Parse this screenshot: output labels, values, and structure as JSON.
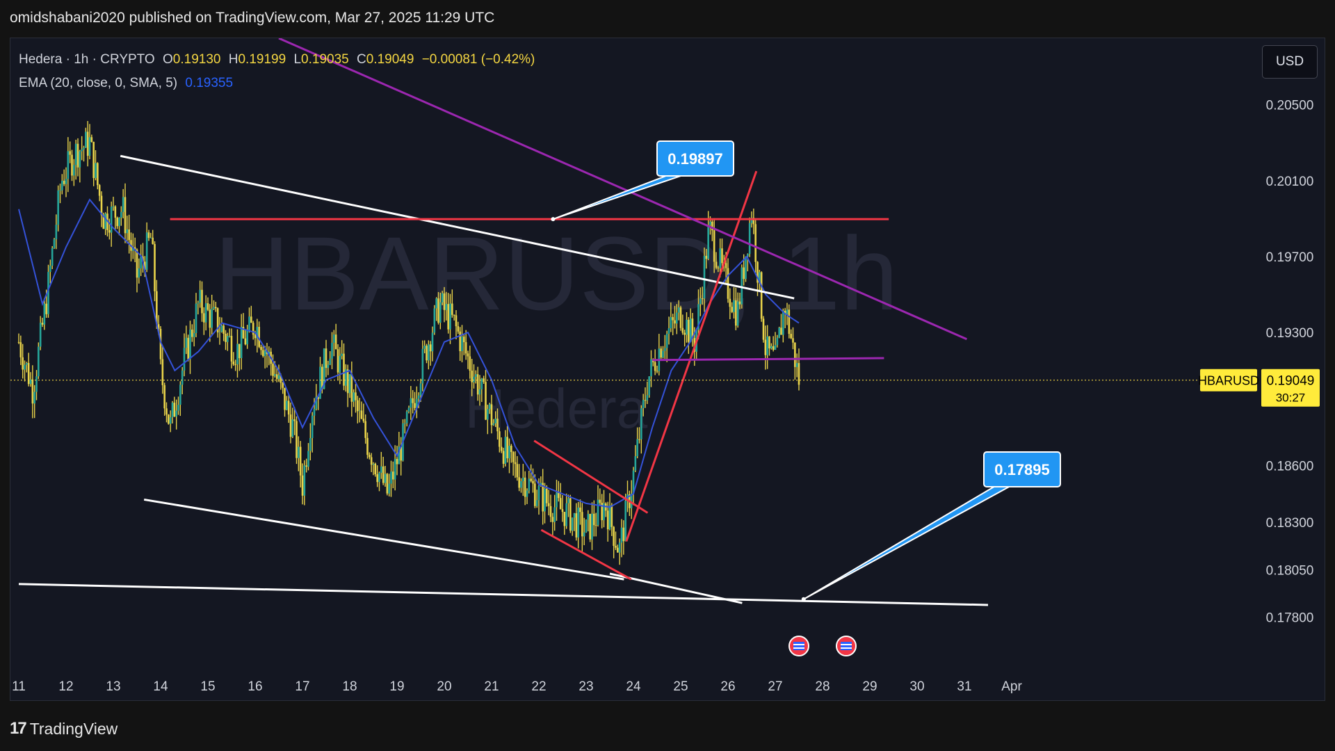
{
  "header": {
    "publisher": "omidshabani2020 published on TradingView.com, Mar 27, 2025 11:29 UTC"
  },
  "legend": {
    "symbol": "Hedera · 1h · CRYPTO",
    "o_label": "O",
    "o_value": "0.19130",
    "h_label": "H",
    "h_value": "0.19199",
    "l_label": "L",
    "l_value": "0.19035",
    "c_label": "C",
    "c_value": "0.19049",
    "change": "−0.00081 (−0.42%)",
    "ema_label": "EMA (20, close, 0, SMA, 5)",
    "ema_value": "0.19355"
  },
  "currency_button": "USD",
  "watermark": {
    "symbol": "HBARUSD, 1h",
    "name": "Hedera"
  },
  "footer": {
    "brand": "TradingView"
  },
  "colors": {
    "background": "#141722",
    "candles": "#e8d34a",
    "ema": "#3452d9",
    "resistance": "#f23645",
    "trendline": "#ffffff",
    "purple": "#9c27b0",
    "label_blue": "#2196f3",
    "price_tag": "#ffeb3b"
  },
  "chart_data": {
    "type": "line",
    "symbol": "HBARUSD",
    "timeframe": "1h",
    "x_ticks": [
      "11",
      "12",
      "13",
      "14",
      "15",
      "16",
      "17",
      "18",
      "19",
      "20",
      "21",
      "22",
      "23",
      "24",
      "25",
      "26",
      "27",
      "28",
      "29",
      "30",
      "31",
      "Apr"
    ],
    "y_ticks": [
      "0.20500",
      "0.20100",
      "0.19700",
      "0.19300",
      "0.18600",
      "0.18300",
      "0.18050",
      "0.17800"
    ],
    "ylim": [
      0.177,
      0.2085
    ],
    "current_price": {
      "symbol": "HBARUSD",
      "value": "0.19049",
      "countdown": "30:27"
    },
    "levels": [
      {
        "name": "resistance",
        "price": 0.19897,
        "label": "0.19897"
      },
      {
        "name": "support",
        "price": 0.17895,
        "label": "0.17895"
      }
    ],
    "close_series": [
      {
        "day": 11.0,
        "price": 0.1925
      },
      {
        "day": 11.3,
        "price": 0.19
      },
      {
        "day": 11.6,
        "price": 0.195
      },
      {
        "day": 11.9,
        "price": 0.201
      },
      {
        "day": 12.2,
        "price": 0.2025
      },
      {
        "day": 12.5,
        "price": 0.203
      },
      {
        "day": 12.8,
        "price": 0.199
      },
      {
        "day": 13.2,
        "price": 0.1995
      },
      {
        "day": 13.5,
        "price": 0.196
      },
      {
        "day": 13.8,
        "price": 0.198
      },
      {
        "day": 14.0,
        "price": 0.191
      },
      {
        "day": 14.2,
        "price": 0.188
      },
      {
        "day": 14.5,
        "price": 0.1915
      },
      {
        "day": 14.8,
        "price": 0.1945
      },
      {
        "day": 15.2,
        "price": 0.1935
      },
      {
        "day": 15.6,
        "price": 0.192
      },
      {
        "day": 16.0,
        "price": 0.1935
      },
      {
        "day": 16.4,
        "price": 0.191
      },
      {
        "day": 16.8,
        "price": 0.188
      },
      {
        "day": 17.0,
        "price": 0.185
      },
      {
        "day": 17.2,
        "price": 0.189
      },
      {
        "day": 17.6,
        "price": 0.1925
      },
      {
        "day": 18.0,
        "price": 0.19
      },
      {
        "day": 18.4,
        "price": 0.187
      },
      {
        "day": 18.8,
        "price": 0.1845
      },
      {
        "day": 19.2,
        "price": 0.188
      },
      {
        "day": 19.6,
        "price": 0.192
      },
      {
        "day": 19.9,
        "price": 0.1945
      },
      {
        "day": 20.2,
        "price": 0.1935
      },
      {
        "day": 20.6,
        "price": 0.191
      },
      {
        "day": 21.0,
        "price": 0.1885
      },
      {
        "day": 21.4,
        "price": 0.186
      },
      {
        "day": 21.8,
        "price": 0.185
      },
      {
        "day": 22.2,
        "price": 0.184
      },
      {
        "day": 22.6,
        "price": 0.1835
      },
      {
        "day": 23.0,
        "price": 0.1825
      },
      {
        "day": 23.4,
        "price": 0.184
      },
      {
        "day": 23.7,
        "price": 0.1815
      },
      {
        "day": 24.0,
        "price": 0.1855
      },
      {
        "day": 24.3,
        "price": 0.1905
      },
      {
        "day": 24.6,
        "price": 0.1925
      },
      {
        "day": 25.0,
        "price": 0.194
      },
      {
        "day": 25.3,
        "price": 0.1925
      },
      {
        "day": 25.6,
        "price": 0.1985
      },
      {
        "day": 25.9,
        "price": 0.196
      },
      {
        "day": 26.2,
        "price": 0.194
      },
      {
        "day": 26.5,
        "price": 0.1995
      },
      {
        "day": 26.8,
        "price": 0.192
      },
      {
        "day": 27.0,
        "price": 0.1915
      },
      {
        "day": 27.2,
        "price": 0.1945
      },
      {
        "day": 27.5,
        "price": 0.1905
      }
    ],
    "ema_series": [
      {
        "day": 11.0,
        "price": 0.1995
      },
      {
        "day": 11.5,
        "price": 0.1945
      },
      {
        "day": 12.0,
        "price": 0.1975
      },
      {
        "day": 12.5,
        "price": 0.2
      },
      {
        "day": 13.0,
        "price": 0.1985
      },
      {
        "day": 13.6,
        "price": 0.197
      },
      {
        "day": 14.0,
        "price": 0.1925
      },
      {
        "day": 14.3,
        "price": 0.191
      },
      {
        "day": 14.8,
        "price": 0.192
      },
      {
        "day": 15.3,
        "price": 0.1935
      },
      {
        "day": 16.0,
        "price": 0.193
      },
      {
        "day": 16.5,
        "price": 0.191
      },
      {
        "day": 17.0,
        "price": 0.188
      },
      {
        "day": 17.5,
        "price": 0.1905
      },
      {
        "day": 18.0,
        "price": 0.191
      },
      {
        "day": 18.5,
        "price": 0.1885
      },
      {
        "day": 19.0,
        "price": 0.1865
      },
      {
        "day": 19.5,
        "price": 0.1895
      },
      {
        "day": 20.0,
        "price": 0.1925
      },
      {
        "day": 20.5,
        "price": 0.193
      },
      {
        "day": 21.0,
        "price": 0.1905
      },
      {
        "day": 21.5,
        "price": 0.187
      },
      {
        "day": 22.0,
        "price": 0.185
      },
      {
        "day": 22.5,
        "price": 0.1845
      },
      {
        "day": 23.0,
        "price": 0.184
      },
      {
        "day": 23.5,
        "price": 0.1838
      },
      {
        "day": 24.0,
        "price": 0.1845
      },
      {
        "day": 24.4,
        "price": 0.188
      },
      {
        "day": 24.8,
        "price": 0.191
      },
      {
        "day": 25.2,
        "price": 0.1925
      },
      {
        "day": 25.6,
        "price": 0.1945
      },
      {
        "day": 26.0,
        "price": 0.196
      },
      {
        "day": 26.4,
        "price": 0.197
      },
      {
        "day": 26.8,
        "price": 0.195
      },
      {
        "day": 27.2,
        "price": 0.194
      },
      {
        "day": 27.5,
        "price": 0.1935
      }
    ],
    "drawings": [
      {
        "name": "upper-channel-line",
        "color": "#ffffff",
        "from": {
          "day": 13.15,
          "price": 0.2023
        },
        "to": {
          "day": 27.4,
          "price": 0.1948
        }
      },
      {
        "name": "lower-channel-line",
        "color": "#ffffff",
        "from": {
          "day": 13.65,
          "price": 0.1842
        },
        "to": {
          "day": 23.8,
          "price": 0.18
        }
      },
      {
        "name": "base-support-line",
        "color": "#ffffff",
        "from": {
          "day": 11.0,
          "price": 0.17975
        },
        "to": {
          "day": 31.5,
          "price": 0.17865
        }
      },
      {
        "name": "lower-support-line-2",
        "color": "#ffffff",
        "from": {
          "day": 23.5,
          "price": 0.1803
        },
        "to": {
          "day": 26.3,
          "price": 0.17875
        }
      },
      {
        "name": "resistance-level-line",
        "color": "#f23645",
        "from": {
          "day": 14.2,
          "price": 0.19897
        },
        "to": {
          "day": 29.4,
          "price": 0.19897
        }
      },
      {
        "name": "small-channel-upper",
        "color": "#f23645",
        "from": {
          "day": 21.9,
          "price": 0.1873
        },
        "to": {
          "day": 24.3,
          "price": 0.1835
        }
      },
      {
        "name": "small-channel-lower",
        "color": "#f23645",
        "from": {
          "day": 22.05,
          "price": 0.1826
        },
        "to": {
          "day": 23.95,
          "price": 0.18
        }
      },
      {
        "name": "breakout-trendline",
        "color": "#f23645",
        "from": {
          "day": 23.85,
          "price": 0.182
        },
        "to": {
          "day": 26.6,
          "price": 0.2015
        }
      },
      {
        "name": "descending-purple-line",
        "color": "#9c27b0",
        "from": {
          "day": 16.5,
          "price": 0.2085
        },
        "to": {
          "day": 31.05,
          "price": 0.19265
        }
      },
      {
        "name": "horizontal-purple-line",
        "color": "#9c27b0",
        "from": {
          "day": 24.4,
          "price": 0.19155
        },
        "to": {
          "day": 29.3,
          "price": 0.19165
        }
      }
    ],
    "event_markers": [
      {
        "day": 27.5,
        "icon": "us-flag-icon"
      },
      {
        "day": 28.5,
        "icon": "us-flag-icon"
      }
    ],
    "grid": false
  }
}
